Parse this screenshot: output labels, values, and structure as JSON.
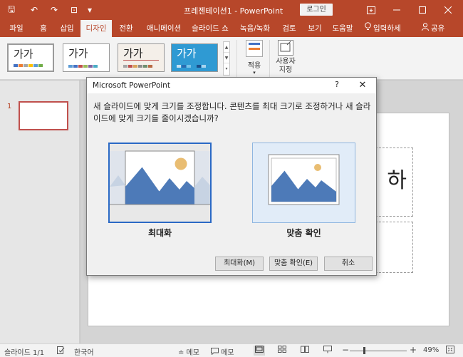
{
  "app": {
    "title": "프레젠테이션1 - PowerPoint",
    "login_label": "로그인",
    "accent_color": "#b7472a"
  },
  "quick_access": [
    {
      "name": "save-icon",
      "glyph": "🖫"
    },
    {
      "name": "undo-icon",
      "glyph": "↶"
    },
    {
      "name": "redo-icon",
      "glyph": "↷"
    },
    {
      "name": "present-icon",
      "glyph": "⊡"
    },
    {
      "name": "customize-icon",
      "glyph": "▾"
    }
  ],
  "tabs": [
    {
      "label": "파일"
    },
    {
      "label": "홈"
    },
    {
      "label": "삽입"
    },
    {
      "label": "디자인",
      "active": true
    },
    {
      "label": "전환"
    },
    {
      "label": "애니메이션"
    },
    {
      "label": "슬라이드 쇼"
    },
    {
      "label": "녹음/녹화"
    },
    {
      "label": "검토"
    },
    {
      "label": "보기"
    },
    {
      "label": "도움말"
    },
    {
      "label": "입력하세",
      "icon": "lightbulb-icon"
    },
    {
      "label": "공유",
      "icon": "person-icon"
    }
  ],
  "ribbon": {
    "themes": [
      {
        "label": "가가",
        "bg": "#ffffff",
        "text": "#222222"
      },
      {
        "label": "가가",
        "bg": "#ffffff",
        "text": "#222222"
      },
      {
        "label": "가가",
        "bg": "#f4efe9",
        "text": "#333333"
      },
      {
        "label": "가가",
        "bg": "#2f9ad3",
        "text": "#ffffff"
      }
    ],
    "apply_label": "적용",
    "custom_label": "사용자 지정"
  },
  "thumbnail": {
    "number": "1"
  },
  "slide": {
    "title_partial": "하"
  },
  "dialog": {
    "title": "Microsoft PowerPoint",
    "help": "?",
    "close": "✕",
    "message": "새 슬라이드에 맞게 크기를 조정합니다. 콘텐츠를 최대 크기로 조정하거나 새 슬라이드에 맞게 크기를 줄이시겠습니까?",
    "option_maximize": "최대화",
    "option_fit": "맞춤 확인",
    "buttons": {
      "maximize": "최대화(M)",
      "fit": "맞춤 확인(E)",
      "cancel": "취소"
    }
  },
  "status": {
    "slide_count": "슬라이드 1/1",
    "language": "한국어",
    "notes_label": "≐ 메모",
    "comments_label": "메모",
    "zoom": "49%"
  }
}
